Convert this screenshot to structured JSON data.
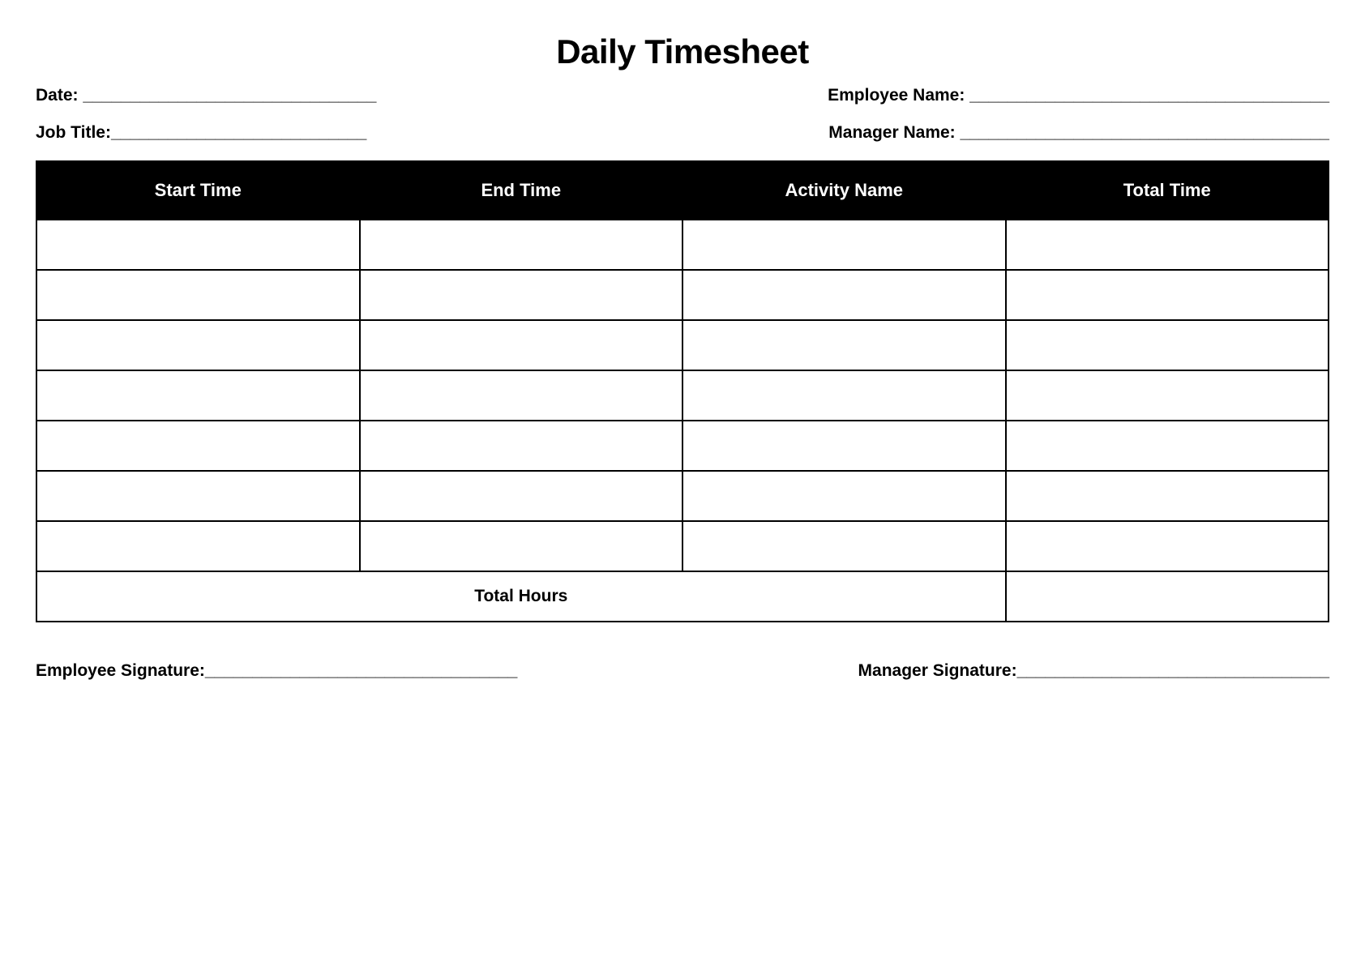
{
  "title": "Daily Timesheet",
  "fields": {
    "date": "Date: _______________________________",
    "employeeName": "Employee Name: ______________________________________",
    "jobTitle": "Job Title:___________________________",
    "managerName": "Manager Name: _______________________________________"
  },
  "columns": {
    "startTime": "Start Time",
    "endTime": "End Time",
    "activityName": "Activity Name",
    "totalTime": "Total Time"
  },
  "rows": [
    {
      "start": "",
      "end": "",
      "activity": "",
      "total": ""
    },
    {
      "start": "",
      "end": "",
      "activity": "",
      "total": ""
    },
    {
      "start": "",
      "end": "",
      "activity": "",
      "total": ""
    },
    {
      "start": "",
      "end": "",
      "activity": "",
      "total": ""
    },
    {
      "start": "",
      "end": "",
      "activity": "",
      "total": ""
    },
    {
      "start": "",
      "end": "",
      "activity": "",
      "total": ""
    },
    {
      "start": "",
      "end": "",
      "activity": "",
      "total": ""
    }
  ],
  "totalHoursLabel": "Total Hours",
  "totalHoursValue": "",
  "signatures": {
    "employee": "Employee Signature:_________________________________",
    "manager": "Manager Signature:_________________________________"
  }
}
